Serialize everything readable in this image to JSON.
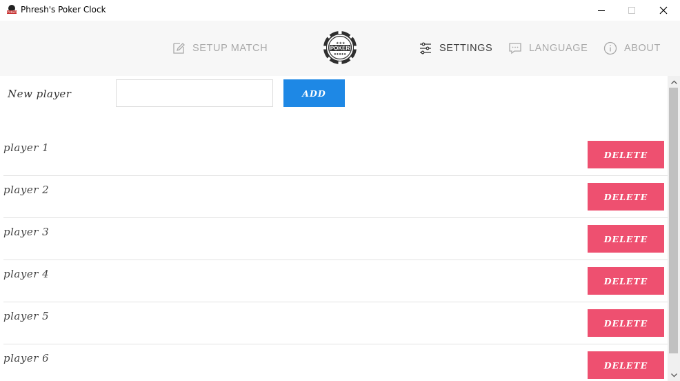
{
  "window": {
    "title": "Phresh's Poker Clock"
  },
  "nav": {
    "setup_match": "SETUP MATCH",
    "settings": "SETTINGS",
    "language": "LANGUAGE",
    "about": "ABOUT",
    "logo_text": "POKER"
  },
  "form": {
    "new_player_label": "New player",
    "input_value": "",
    "add_label": "ADD"
  },
  "players": [
    {
      "name": "player 1",
      "delete_label": "DELETE"
    },
    {
      "name": "player 2",
      "delete_label": "DELETE"
    },
    {
      "name": "player 3",
      "delete_label": "DELETE"
    },
    {
      "name": "player 4",
      "delete_label": "DELETE"
    },
    {
      "name": "player 5",
      "delete_label": "DELETE"
    },
    {
      "name": "player 6",
      "delete_label": "DELETE"
    }
  ],
  "colors": {
    "add_button": "#1e88e5",
    "delete_button": "#ee5070",
    "nav_background": "#f7f7f7",
    "nav_inactive": "#a9a9a9",
    "nav_active": "#3a3a3a"
  },
  "icons": {
    "app": "poker-chip-icon",
    "setup_match": "edit-icon",
    "settings": "sliders-icon",
    "language": "chat-icon",
    "about": "info-icon"
  }
}
